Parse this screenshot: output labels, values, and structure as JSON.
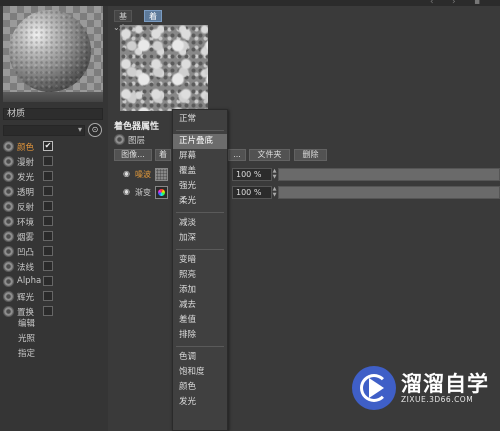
{
  "tabs": [
    "基本",
    "着色器"
  ],
  "active_tab": "着色器",
  "collapse_glyph": "⌄",
  "material": {
    "name": "材质"
  },
  "channels": [
    {
      "label": "颜色",
      "checked": true,
      "active": true
    },
    {
      "label": "漫射",
      "checked": false
    },
    {
      "label": "发光",
      "checked": false
    },
    {
      "label": "透明",
      "checked": false
    },
    {
      "label": "反射",
      "checked": false
    },
    {
      "label": "环境",
      "checked": false
    },
    {
      "label": "烟雾",
      "checked": false
    },
    {
      "label": "凹凸",
      "checked": false
    },
    {
      "label": "法线",
      "checked": false
    },
    {
      "label": "Alpha",
      "checked": false
    },
    {
      "label": "辉光",
      "checked": false
    },
    {
      "label": "置换",
      "checked": false
    }
  ],
  "sub_links": [
    "编辑",
    "光照",
    "指定"
  ],
  "shader": {
    "section_title": "着色器属性",
    "layer_label": "图层",
    "buttons": [
      "图像...",
      "着",
      "...",
      "文件夹",
      "删除"
    ]
  },
  "layers": [
    {
      "name": "噪波",
      "thumb": "noise",
      "percent": "100 %"
    },
    {
      "name": "渐变",
      "thumb": "gradient",
      "percent": "100 %"
    }
  ],
  "blend_menu": {
    "selected": "正片叠底",
    "groups": [
      [
        "正常"
      ],
      [
        "正片叠底",
        "屏幕",
        "覆盖",
        "强光",
        "柔光"
      ],
      [
        "减淡",
        "加深"
      ],
      [
        "变暗",
        "照亮",
        "添加",
        "减去",
        "差值",
        "排除"
      ],
      [
        "色调",
        "饱和度",
        "颜色",
        "发光"
      ]
    ]
  },
  "watermark": {
    "text": "溜溜自学",
    "url": "ZIXUE.3D66.COM"
  }
}
